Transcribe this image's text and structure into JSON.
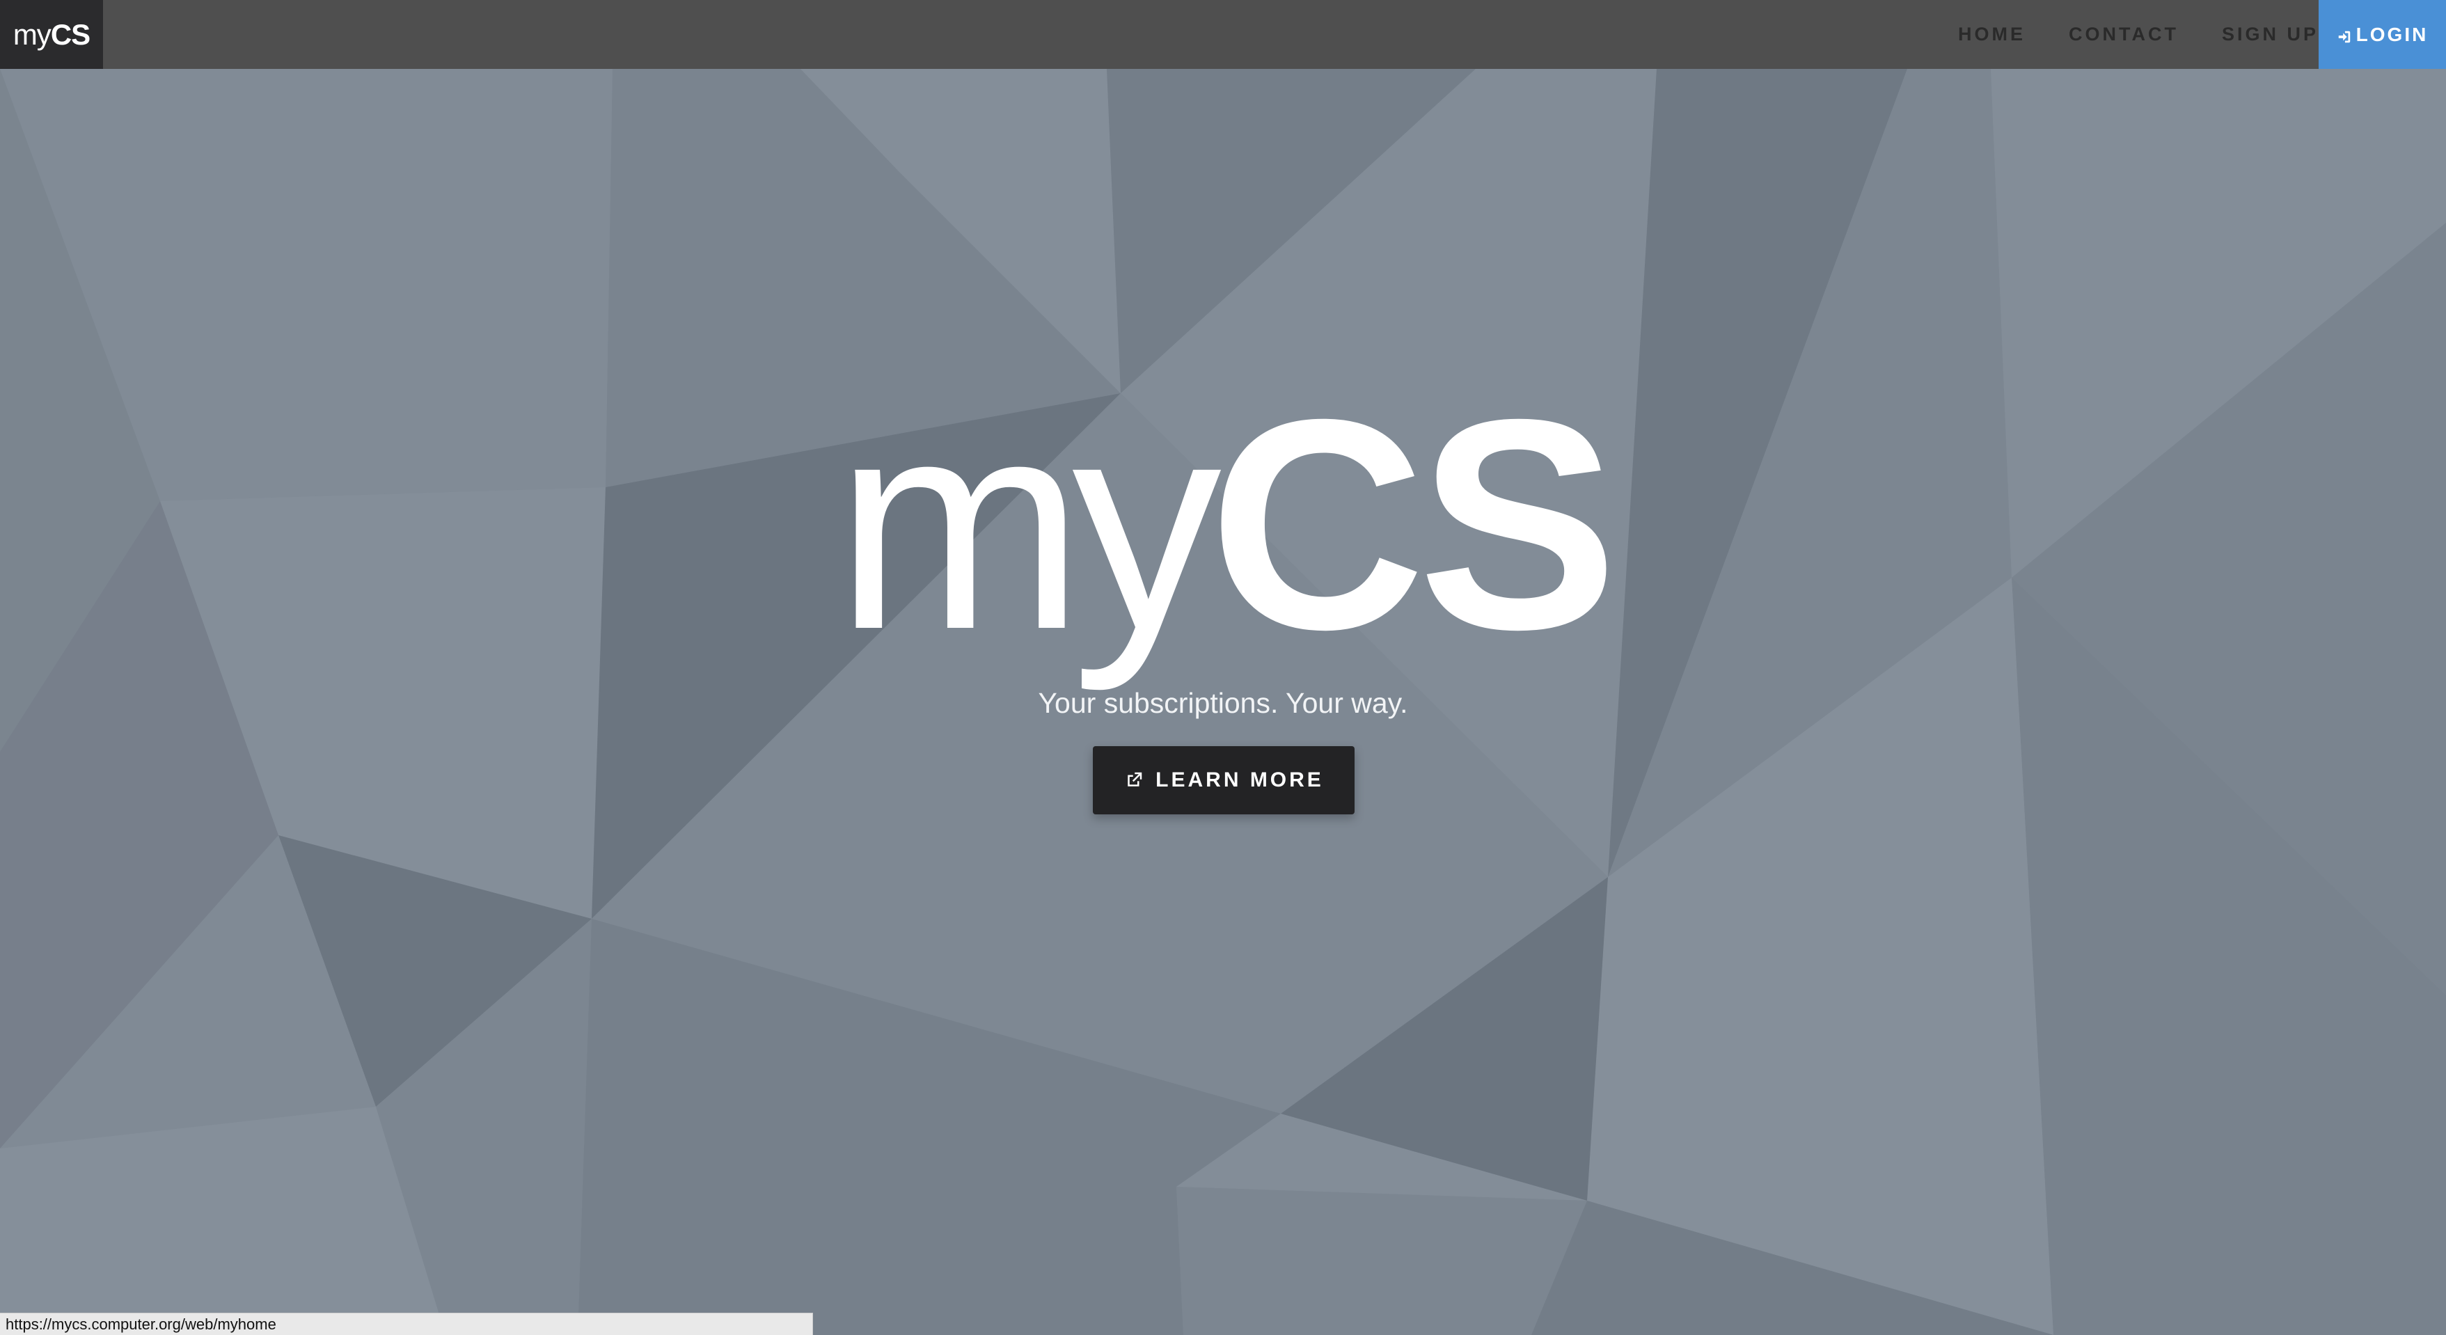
{
  "brand": {
    "light": "my",
    "bold": "CS"
  },
  "nav": {
    "items": [
      {
        "label": "HOME"
      },
      {
        "label": "CONTACT"
      },
      {
        "label": "SIGN UP"
      }
    ],
    "login_label": "LOGIN",
    "login_icon": "sign-in-icon",
    "login_color": "#4a90d6"
  },
  "hero": {
    "title_light": "my",
    "title_bold": "CS",
    "tagline": "Your subscriptions. Your way.",
    "cta_label": "LEARN MORE",
    "cta_icon": "external-link-icon"
  },
  "status": {
    "url": "https://mycs.computer.org/web/myhome"
  },
  "colors": {
    "navbar": "#4f4f4f",
    "brand_bg": "#2b2b2d",
    "accent": "#4a90d6",
    "cta_bg": "#232325",
    "background": "#7e8893"
  }
}
